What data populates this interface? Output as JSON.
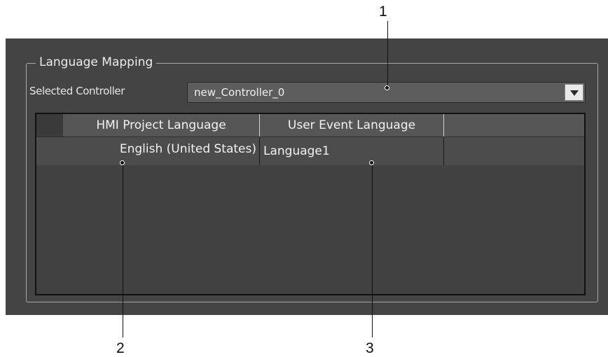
{
  "group": {
    "title": "Language Mapping"
  },
  "controller": {
    "label": "Selected Controller",
    "selected": "new_Controller_0"
  },
  "table": {
    "headers": [
      "HMI Project Language",
      "User Event Language"
    ],
    "rows": [
      [
        "English (United States)",
        "Language1"
      ]
    ]
  },
  "callouts": [
    "1",
    "2",
    "3"
  ],
  "icons": {
    "dropdown": "triangle-down-icon"
  }
}
